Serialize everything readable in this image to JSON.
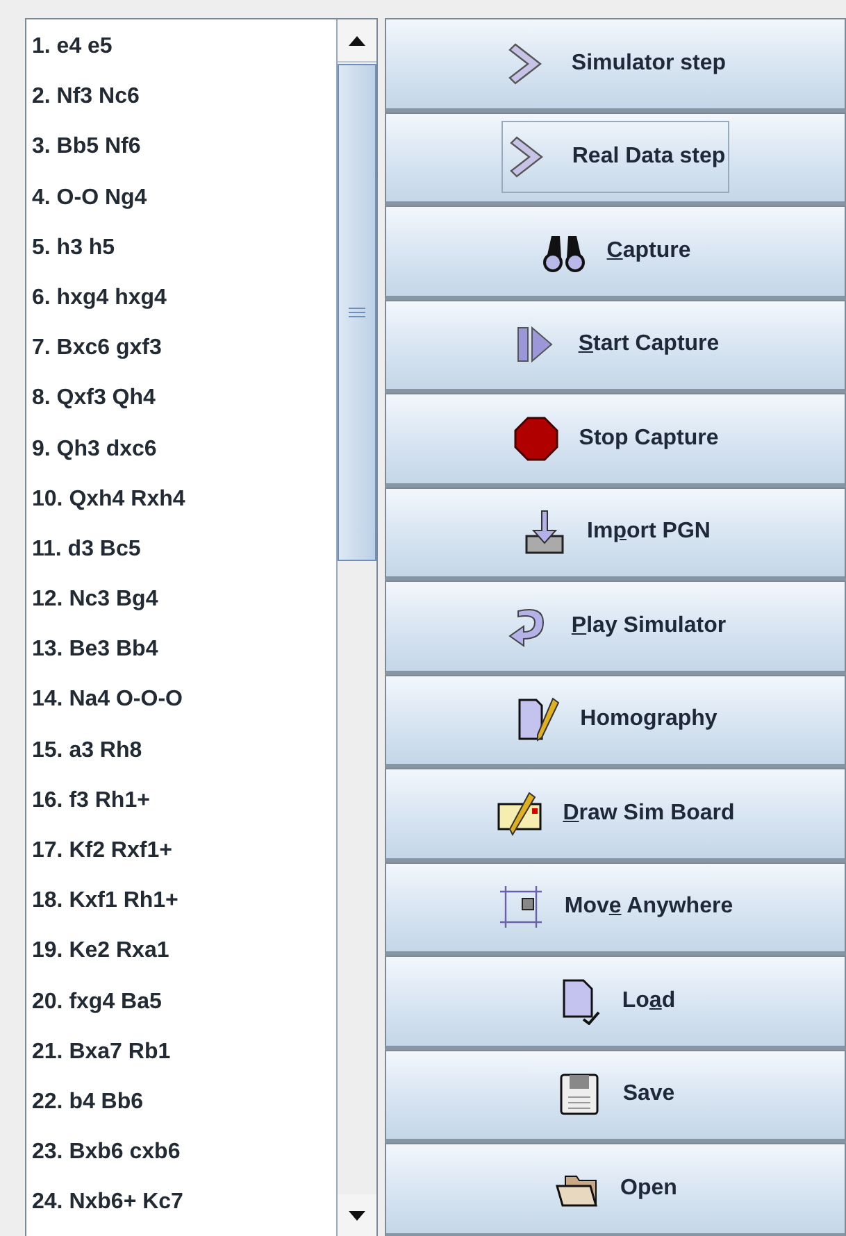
{
  "moves": [
    "1. e4 e5",
    "2. Nf3 Nc6",
    "3. Bb5 Nf6",
    "4. O-O Ng4",
    "5. h3 h5",
    "6. hxg4 hxg4",
    "7. Bxc6 gxf3",
    "8. Qxf3 Qh4",
    "9. Qh3 dxc6",
    "10. Qxh4 Rxh4",
    "11. d3 Bc5",
    "12. Nc3 Bg4",
    "13. Be3 Bb4",
    "14. Na4 O-O-O",
    "15. a3 Rh8",
    "16. f3 Rh1+",
    "17. Kf2 Rxf1+",
    "18. Kxf1 Rh1+",
    "19. Ke2 Rxa1",
    "20. fxg4 Ba5",
    "21. Bxa7 Rb1",
    "22. b4 Bb6",
    "23. Bxb6 cxb6",
    "24. Nxb6+ Kc7"
  ],
  "buttons": [
    {
      "kind": "chevron",
      "label": [
        {
          "text": "Simulator step",
          "underlined": false
        }
      ],
      "focused": false
    },
    {
      "kind": "chevron",
      "label": [
        {
          "text": "Real Data step",
          "underlined": false
        }
      ],
      "focused": true
    },
    {
      "kind": "binoculars",
      "label": [
        {
          "text": "C",
          "underlined": true
        },
        {
          "text": "apture",
          "underlined": false
        }
      ],
      "focused": false
    },
    {
      "kind": "start",
      "label": [
        {
          "text": "S",
          "underlined": true
        },
        {
          "text": "tart Capture",
          "underlined": false
        }
      ],
      "focused": false
    },
    {
      "kind": "stop",
      "label": [
        {
          "text": "Stop Capture",
          "underlined": false
        }
      ],
      "focused": false
    },
    {
      "kind": "import",
      "label": [
        {
          "text": "Im",
          "underlined": false
        },
        {
          "text": "p",
          "underlined": true
        },
        {
          "text": "ort PGN",
          "underlined": false
        }
      ],
      "focused": false
    },
    {
      "kind": "play",
      "label": [
        {
          "text": "P",
          "underlined": true
        },
        {
          "text": "lay Simulator",
          "underlined": false
        }
      ],
      "focused": false
    },
    {
      "kind": "homography",
      "label": [
        {
          "text": "Homography",
          "underlined": false
        }
      ],
      "focused": false
    },
    {
      "kind": "draw",
      "label": [
        {
          "text": "D",
          "underlined": true
        },
        {
          "text": "raw Sim Board",
          "underlined": false
        }
      ],
      "focused": false
    },
    {
      "kind": "move",
      "label": [
        {
          "text": "Mov",
          "underlined": false
        },
        {
          "text": "e",
          "underlined": true
        },
        {
          "text": " Anywhere",
          "underlined": false
        }
      ],
      "focused": false
    },
    {
      "kind": "load",
      "label": [
        {
          "text": "Lo",
          "underlined": false
        },
        {
          "text": "a",
          "underlined": true
        },
        {
          "text": "d",
          "underlined": false
        }
      ],
      "focused": false
    },
    {
      "kind": "save",
      "label": [
        {
          "text": "Save",
          "underlined": false
        }
      ],
      "focused": false
    },
    {
      "kind": "open",
      "label": [
        {
          "text": "Open",
          "underlined": false
        }
      ],
      "focused": false
    }
  ]
}
